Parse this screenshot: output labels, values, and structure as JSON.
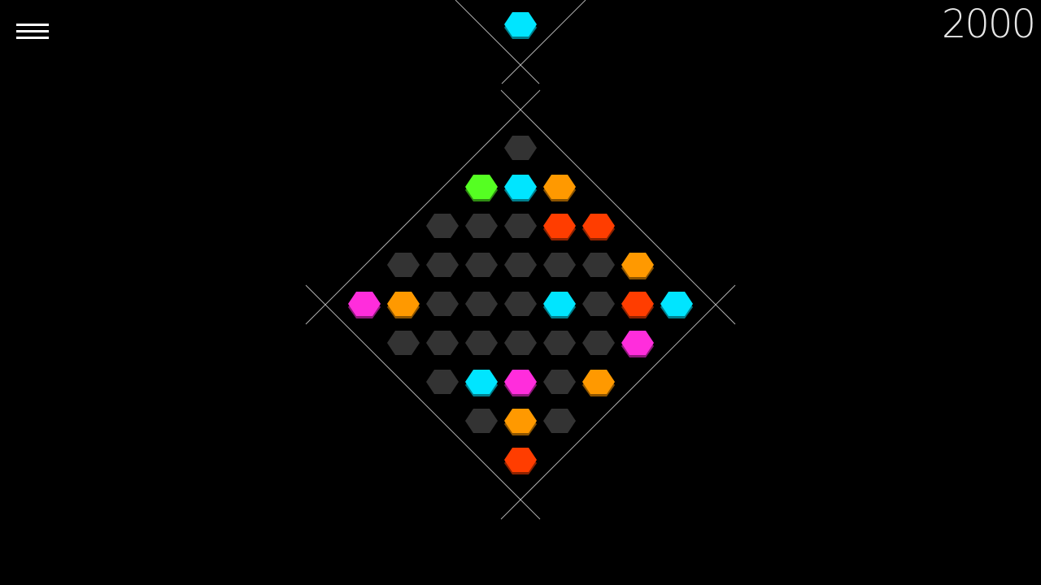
{
  "hud": {
    "score": "2000",
    "menu_icon": "hamburger-menu-icon"
  },
  "palette": {
    "empty": "#333333",
    "cyan": "#00e5ff",
    "orange": "#ff9900",
    "red": "#ff3d00",
    "green": "#55ff22",
    "magenta": "#ff2ddc",
    "guide_line": "#cccccc"
  },
  "next_piece": "cyan",
  "board": {
    "rows": [
      [
        "empty"
      ],
      [
        "green",
        "cyan",
        "orange"
      ],
      [
        "empty",
        "empty",
        "empty",
        "red",
        "red"
      ],
      [
        "empty",
        "empty",
        "empty",
        "empty",
        "empty",
        "empty",
        "orange"
      ],
      [
        "magenta",
        "orange",
        "empty",
        "empty",
        "empty",
        "cyan",
        "empty",
        "red",
        "cyan"
      ],
      [
        "empty",
        "empty",
        "empty",
        "empty",
        "empty",
        "empty",
        "magenta"
      ],
      [
        "empty",
        "cyan",
        "magenta",
        "empty",
        "orange"
      ],
      [
        "empty",
        "orange",
        "empty"
      ],
      [
        "red"
      ]
    ]
  }
}
